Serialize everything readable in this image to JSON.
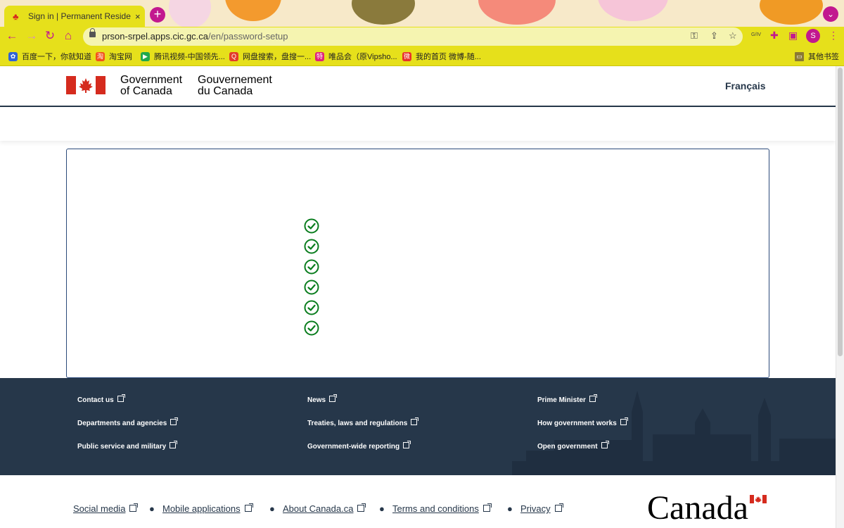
{
  "browser": {
    "tab_title": "Sign in | Permanent Residence",
    "tab_close": "×",
    "new_tab": "+",
    "url_domain": "prson-srpel.apps.cic.gc.ca",
    "url_path": "/en/password-setup",
    "profile_initial": "S",
    "bookmarks": [
      {
        "label": "百度一下，你就知道",
        "icon": "paw-icon",
        "color": "#2f63d6"
      },
      {
        "label": "淘宝网",
        "icon": "taobao-icon",
        "color": "#f2531b"
      },
      {
        "label": "腾讯视频-中国领先...",
        "icon": "play-icon",
        "color": "#20a84d"
      },
      {
        "label": "网盘搜索，盘搜一...",
        "icon": "search-icon",
        "color": "#e33b2a"
      },
      {
        "label": "唯品会（原Vipsho...",
        "icon": "vip-icon",
        "color": "#e0227a"
      },
      {
        "label": "我的首页 微博-随...",
        "icon": "weibo-icon",
        "color": "#e8322a"
      }
    ],
    "other_bookmarks": "其他书签"
  },
  "header": {
    "wordmark_en_line1": "Government",
    "wordmark_en_line2": "of Canada",
    "wordmark_fr_line1": "Gouvernement",
    "wordmark_fr_line2": "du Canada",
    "language_toggle": "Français"
  },
  "main": {
    "checklist_count": 6,
    "check_color": "#0a7d1e"
  },
  "footer": {
    "columns": [
      [
        "Contact us",
        "Departments and agencies",
        "Public service and military"
      ],
      [
        "News",
        "Treaties, laws and regulations",
        "Government-wide reporting"
      ],
      [
        "Prime Minister",
        "How government works",
        "Open government"
      ]
    ],
    "bottom_links": [
      "Social media",
      "Mobile applications",
      "About Canada.ca",
      "Terms and conditions",
      "Privacy"
    ],
    "separator": "●",
    "canada_wordmark": "Canada",
    "colors": {
      "footer_bg": "#26374a",
      "flag_red": "#d52b1e"
    }
  }
}
